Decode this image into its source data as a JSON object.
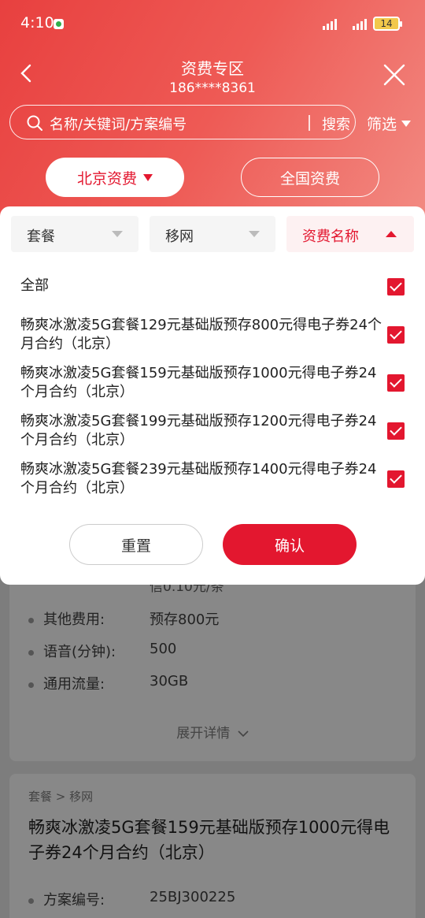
{
  "status_bar": {
    "time": "4:10",
    "battery": "14"
  },
  "nav": {
    "title": "资费专区",
    "phone": "186****8361"
  },
  "search": {
    "placeholder": "名称/关键词/方案编号",
    "button": "搜索"
  },
  "filter_label": "筛选",
  "region_tabs": [
    {
      "label": "北京资费",
      "selected": true
    },
    {
      "label": "全国资费",
      "selected": false
    }
  ],
  "panel": {
    "dropdowns": [
      {
        "label": "套餐"
      },
      {
        "label": "移网"
      },
      {
        "label": "资费名称",
        "active": true
      }
    ],
    "options": [
      {
        "label": "全部",
        "checked": true
      },
      {
        "label": "畅爽冰激凌5G套餐129元基础版预存800元得电子券24个月合约（北京）",
        "checked": true
      },
      {
        "label": "畅爽冰激凌5G套餐159元基础版预存1000元得电子券24个月合约（北京）",
        "checked": true
      },
      {
        "label": "畅爽冰激凌5G套餐199元基础版预存1200元得电子券24个月合约（北京）",
        "checked": true
      },
      {
        "label": "畅爽冰激凌5G套餐239元基础版预存1400元得电子券24个月合约（北京）",
        "checked": true
      }
    ],
    "reset_label": "重置",
    "confirm_label": "确认"
  },
  "background": {
    "card1": {
      "fragment": "信0.10元/条",
      "rows": [
        {
          "label": "其他费用:",
          "value": "预存800元"
        },
        {
          "label": "语音(分钟):",
          "value": "500"
        },
        {
          "label": "通用流量:",
          "value": "30GB"
        }
      ],
      "expand_label": "展开详情"
    },
    "card2": {
      "breadcrumb": "套餐 > 移网",
      "title": "畅爽冰激凌5G套餐159元基础版预存1000元得电子券24个月合约（北京）",
      "rows": [
        {
          "label": "方案编号:",
          "value": "25BJ300225"
        }
      ]
    }
  },
  "colors": {
    "accent": "#e3172f",
    "header_gradient_start": "#e8403f",
    "header_gradient_end": "#f28a82"
  }
}
